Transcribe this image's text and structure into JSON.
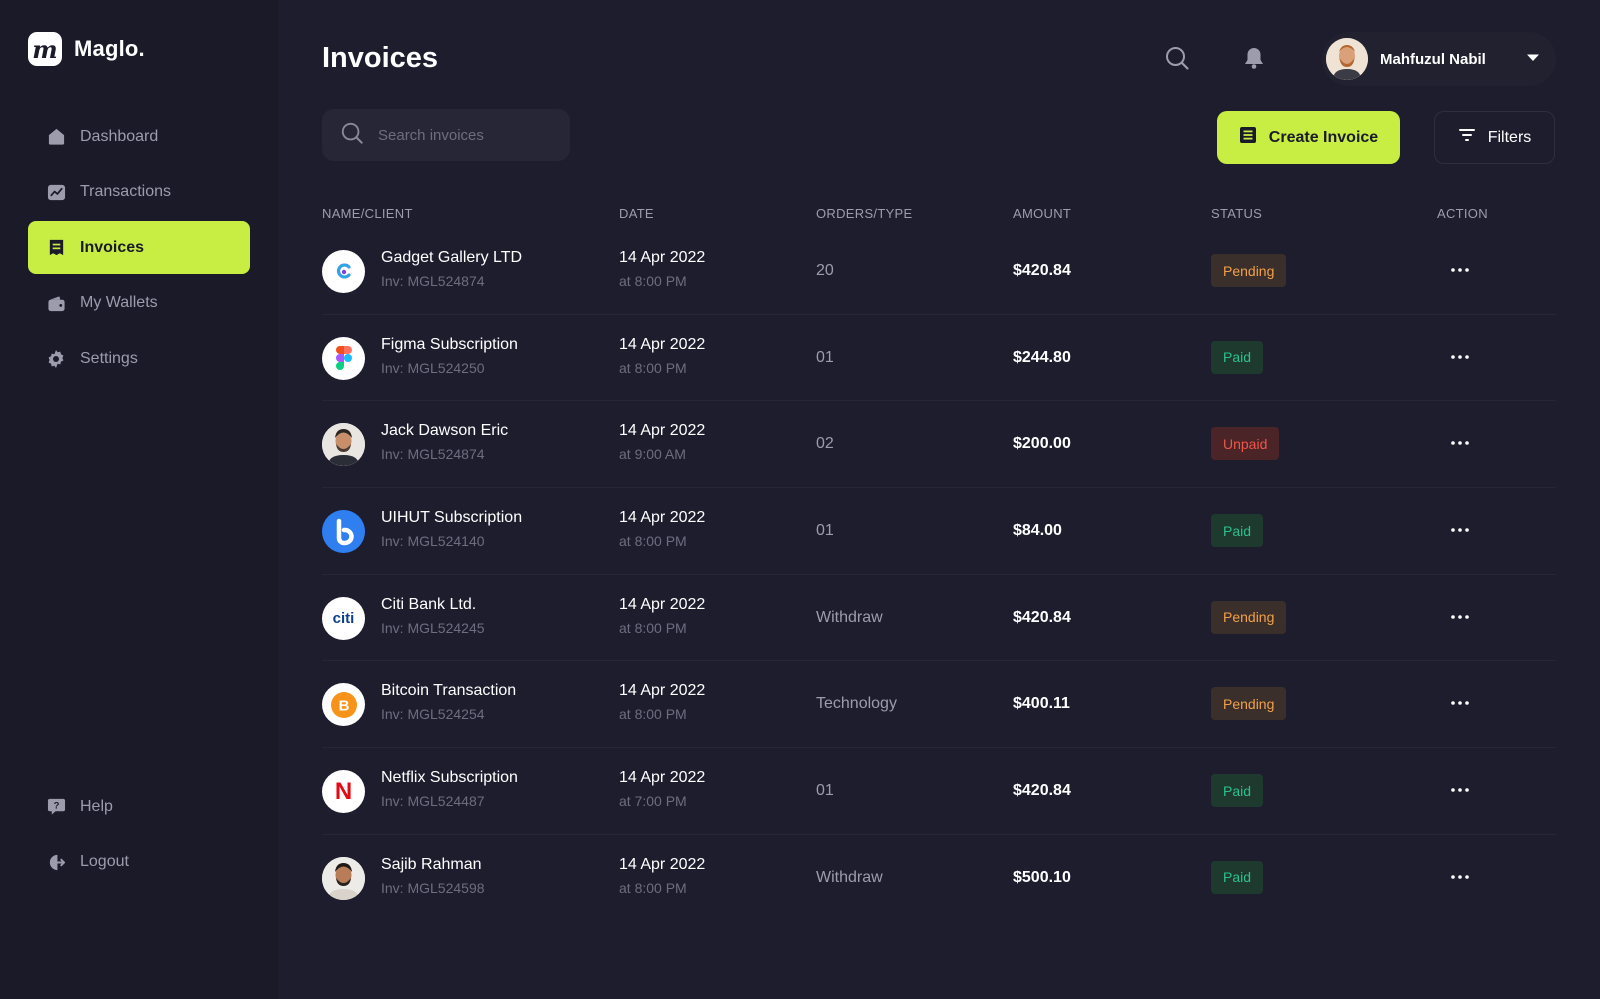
{
  "app": {
    "name": "Maglo.",
    "logo_letter": "m"
  },
  "sidebar": {
    "items": [
      {
        "label": "Dashboard",
        "icon": "home-icon"
      },
      {
        "label": "Transactions",
        "icon": "chart-icon"
      },
      {
        "label": "Invoices",
        "icon": "invoice-icon",
        "active": true
      },
      {
        "label": "My Wallets",
        "icon": "wallet-icon"
      },
      {
        "label": "Settings",
        "icon": "gear-icon"
      }
    ],
    "bottom": [
      {
        "label": "Help",
        "icon": "help-icon"
      },
      {
        "label": "Logout",
        "icon": "logout-icon"
      }
    ]
  },
  "header": {
    "title": "Invoices",
    "user_name": "Mahfuzul Nabil"
  },
  "toolbar": {
    "search_placeholder": "Search invoices",
    "create_label": "Create Invoice",
    "filters_label": "Filters"
  },
  "table": {
    "columns": [
      "NAME/CLIENT",
      "DATE",
      "ORDERS/TYPE",
      "AMOUNT",
      "STATUS",
      "ACTION"
    ],
    "rows": [
      {
        "name": "Gadget Gallery LTD",
        "inv": "Inv: MGL524874",
        "date": "14 Apr 2022",
        "time": "at 8:00 PM",
        "order": "20",
        "amount": "$420.84",
        "status": "Pending",
        "logo": "gadget-gallery-logo"
      },
      {
        "name": "Figma Subscription",
        "inv": "Inv: MGL524250",
        "date": "14 Apr 2022",
        "time": "at 8:00 PM",
        "order": "01",
        "amount": "$244.80",
        "status": "Paid",
        "logo": "figma-logo"
      },
      {
        "name": "Jack Dawson Eric",
        "inv": "Inv: MGL524874",
        "date": "14 Apr 2022",
        "time": "at 9:00 AM",
        "order": "02",
        "amount": "$200.00",
        "status": "Unpaid",
        "logo": "person-avatar"
      },
      {
        "name": "UIHUT Subscription",
        "inv": "Inv: MGL524140",
        "date": "14 Apr 2022",
        "time": "at 8:00 PM",
        "order": "01",
        "amount": "$84.00",
        "status": "Paid",
        "logo": "uihut-logo"
      },
      {
        "name": "Citi Bank Ltd.",
        "inv": "Inv: MGL524245",
        "date": "14 Apr 2022",
        "time": "at 8:00 PM",
        "order": "Withdraw",
        "amount": "$420.84",
        "status": "Pending",
        "logo": "citi-logo",
        "logo_text": "citi"
      },
      {
        "name": "Bitcoin Transaction",
        "inv": "Inv: MGL524254",
        "date": "14 Apr 2022",
        "time": "at 8:00 PM",
        "order": "Technology",
        "amount": "$400.11",
        "status": "Pending",
        "logo": "bitcoin-logo"
      },
      {
        "name": "Netflix Subscription",
        "inv": "Inv: MGL524487",
        "date": "14 Apr 2022",
        "time": "at 7:00 PM",
        "order": "01",
        "amount": "$420.84",
        "status": "Paid",
        "logo": "netflix-logo",
        "logo_text": "N"
      },
      {
        "name": "Sajib Rahman",
        "inv": "Inv: MGL524598",
        "date": "14 Apr 2022",
        "time": "at 8:00 PM",
        "order": "Withdraw",
        "amount": "$500.10",
        "status": "Paid",
        "logo": "person-avatar"
      }
    ]
  },
  "colors": {
    "accent": "#c8ee44",
    "background": "#1e1d2e",
    "sidebar": "#1b1a29",
    "pending": "#f2a049",
    "paid": "#2ec08a",
    "unpaid": "#f0554a"
  }
}
